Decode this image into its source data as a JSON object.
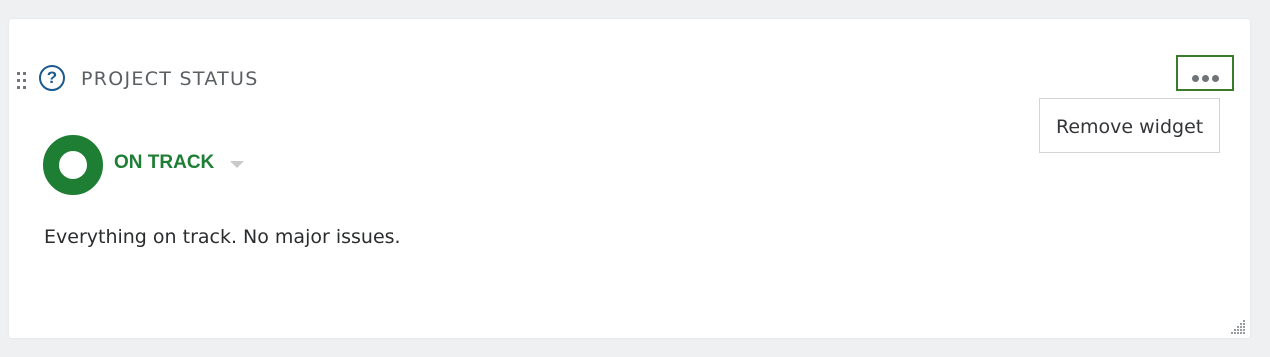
{
  "widget": {
    "title": "PROJECT STATUS",
    "help_icon_glyph": "?",
    "icons": {
      "drag": "drag-handle-icon",
      "help": "question-circle-icon",
      "more": "more-horizontal-icon",
      "status": "status-ring-icon",
      "caret": "caret-down-icon",
      "resize": "resize-grip-icon"
    },
    "menu": {
      "items": [
        {
          "label": "Remove widget"
        }
      ]
    },
    "status": {
      "label": "ON TRACK",
      "description": "Everything on track. No major issues.",
      "color": "#1e7e34"
    },
    "accent_colors": {
      "help_icon": "#1b5a8f",
      "focus_outline": "#3b7a2b"
    }
  }
}
